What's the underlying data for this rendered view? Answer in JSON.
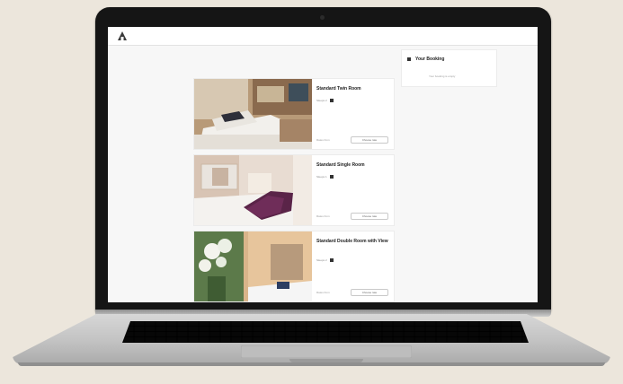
{
  "website": {
    "rooms": [
      {
        "title": "Standard Twin Room",
        "occupancy_text": "Sleeps 2",
        "occupancy_icon": "person-icon",
        "price_text": "Rates from",
        "button_label": "Choose rate"
      },
      {
        "title": "Standard Single Room",
        "occupancy_text": "Sleeps 1",
        "occupancy_icon": "person-icon",
        "price_text": "Rates from",
        "button_label": "Choose rate"
      },
      {
        "title": "Standard Double Room with View",
        "occupancy_text": "Sleeps 2",
        "occupancy_icon": "person-icon",
        "price_text": "Rates from",
        "button_label": "Choose rate"
      }
    ],
    "booking": {
      "title": "Your Booking",
      "empty_text": "Your booking is empty"
    }
  }
}
